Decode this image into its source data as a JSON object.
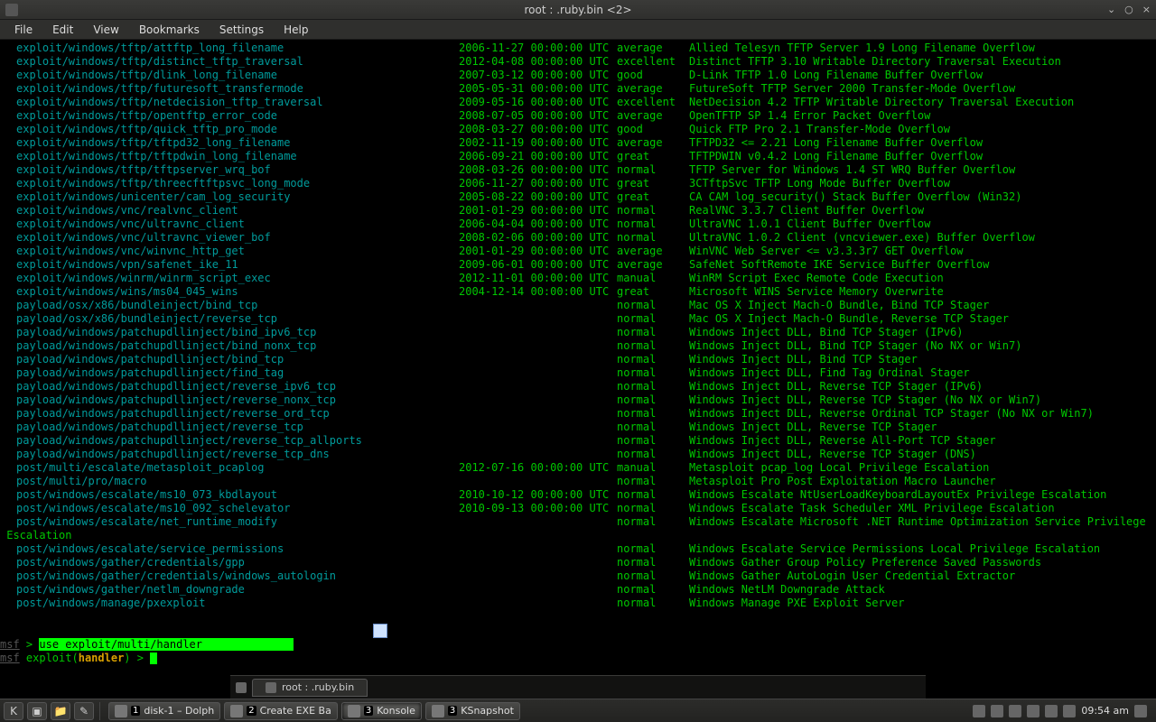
{
  "window": {
    "title": "root : .ruby.bin <2>",
    "controls": {
      "min": "⌄",
      "max": "○",
      "close": "×"
    }
  },
  "menubar": [
    "File",
    "Edit",
    "View",
    "Bookmarks",
    "Settings",
    "Help"
  ],
  "rows": [
    {
      "name": "exploit/windows/tftp/attftp_long_filename",
      "date": "2006-11-27 00:00:00 UTC",
      "rank": "average",
      "desc": "Allied Telesyn TFTP Server 1.9 Long Filename Overflow"
    },
    {
      "name": "exploit/windows/tftp/distinct_tftp_traversal",
      "date": "2012-04-08 00:00:00 UTC",
      "rank": "excellent",
      "desc": "Distinct TFTP 3.10 Writable Directory Traversal Execution"
    },
    {
      "name": "exploit/windows/tftp/dlink_long_filename",
      "date": "2007-03-12 00:00:00 UTC",
      "rank": "good",
      "desc": "D-Link TFTP 1.0 Long Filename Buffer Overflow"
    },
    {
      "name": "exploit/windows/tftp/futuresoft_transfermode",
      "date": "2005-05-31 00:00:00 UTC",
      "rank": "average",
      "desc": "FutureSoft TFTP Server 2000 Transfer-Mode Overflow"
    },
    {
      "name": "exploit/windows/tftp/netdecision_tftp_traversal",
      "date": "2009-05-16 00:00:00 UTC",
      "rank": "excellent",
      "desc": "NetDecision 4.2 TFTP Writable Directory Traversal Execution"
    },
    {
      "name": "exploit/windows/tftp/opentftp_error_code",
      "date": "2008-07-05 00:00:00 UTC",
      "rank": "average",
      "desc": "OpenTFTP SP 1.4 Error Packet Overflow"
    },
    {
      "name": "exploit/windows/tftp/quick_tftp_pro_mode",
      "date": "2008-03-27 00:00:00 UTC",
      "rank": "good",
      "desc": "Quick FTP Pro 2.1 Transfer-Mode Overflow"
    },
    {
      "name": "exploit/windows/tftp/tftpd32_long_filename",
      "date": "2002-11-19 00:00:00 UTC",
      "rank": "average",
      "desc": "TFTPD32 <= 2.21 Long Filename Buffer Overflow"
    },
    {
      "name": "exploit/windows/tftp/tftpdwin_long_filename",
      "date": "2006-09-21 00:00:00 UTC",
      "rank": "great",
      "desc": "TFTPDWIN v0.4.2 Long Filename Buffer Overflow"
    },
    {
      "name": "exploit/windows/tftp/tftpserver_wrq_bof",
      "date": "2008-03-26 00:00:00 UTC",
      "rank": "normal",
      "desc": "TFTP Server for Windows 1.4 ST WRQ Buffer Overflow"
    },
    {
      "name": "exploit/windows/tftp/threecftftpsvc_long_mode",
      "date": "2006-11-27 00:00:00 UTC",
      "rank": "great",
      "desc": "3CTftpSvc TFTP Long Mode Buffer Overflow"
    },
    {
      "name": "exploit/windows/unicenter/cam_log_security",
      "date": "2005-08-22 00:00:00 UTC",
      "rank": "great",
      "desc": "CA CAM log_security() Stack Buffer Overflow (Win32)"
    },
    {
      "name": "exploit/windows/vnc/realvnc_client",
      "date": "2001-01-29 00:00:00 UTC",
      "rank": "normal",
      "desc": "RealVNC 3.3.7 Client Buffer Overflow"
    },
    {
      "name": "exploit/windows/vnc/ultravnc_client",
      "date": "2006-04-04 00:00:00 UTC",
      "rank": "normal",
      "desc": "UltraVNC 1.0.1 Client Buffer Overflow"
    },
    {
      "name": "exploit/windows/vnc/ultravnc_viewer_bof",
      "date": "2008-02-06 00:00:00 UTC",
      "rank": "normal",
      "desc": "UltraVNC 1.0.2 Client (vncviewer.exe) Buffer Overflow"
    },
    {
      "name": "exploit/windows/vnc/winvnc_http_get",
      "date": "2001-01-29 00:00:00 UTC",
      "rank": "average",
      "desc": "WinVNC Web Server <= v3.3.3r7 GET Overflow"
    },
    {
      "name": "exploit/windows/vpn/safenet_ike_11",
      "date": "2009-06-01 00:00:00 UTC",
      "rank": "average",
      "desc": "SafeNet SoftRemote IKE Service Buffer Overflow"
    },
    {
      "name": "exploit/windows/winrm/winrm_script_exec",
      "date": "2012-11-01 00:00:00 UTC",
      "rank": "manual",
      "desc": "WinRM Script Exec Remote Code Execution"
    },
    {
      "name": "exploit/windows/wins/ms04_045_wins",
      "date": "2004-12-14 00:00:00 UTC",
      "rank": "great",
      "desc": "Microsoft WINS Service Memory Overwrite"
    },
    {
      "name": "payload/osx/x86/bundleinject/bind_tcp",
      "date": "",
      "rank": "normal",
      "desc": "Mac OS X Inject Mach-O Bundle, Bind TCP Stager"
    },
    {
      "name": "payload/osx/x86/bundleinject/reverse_tcp",
      "date": "",
      "rank": "normal",
      "desc": "Mac OS X Inject Mach-O Bundle, Reverse TCP Stager"
    },
    {
      "name": "payload/windows/patchupdllinject/bind_ipv6_tcp",
      "date": "",
      "rank": "normal",
      "desc": "Windows Inject DLL, Bind TCP Stager (IPv6)"
    },
    {
      "name": "payload/windows/patchupdllinject/bind_nonx_tcp",
      "date": "",
      "rank": "normal",
      "desc": "Windows Inject DLL, Bind TCP Stager (No NX or Win7)"
    },
    {
      "name": "payload/windows/patchupdllinject/bind_tcp",
      "date": "",
      "rank": "normal",
      "desc": "Windows Inject DLL, Bind TCP Stager"
    },
    {
      "name": "payload/windows/patchupdllinject/find_tag",
      "date": "",
      "rank": "normal",
      "desc": "Windows Inject DLL, Find Tag Ordinal Stager"
    },
    {
      "name": "payload/windows/patchupdllinject/reverse_ipv6_tcp",
      "date": "",
      "rank": "normal",
      "desc": "Windows Inject DLL, Reverse TCP Stager (IPv6)"
    },
    {
      "name": "payload/windows/patchupdllinject/reverse_nonx_tcp",
      "date": "",
      "rank": "normal",
      "desc": "Windows Inject DLL, Reverse TCP Stager (No NX or Win7)"
    },
    {
      "name": "payload/windows/patchupdllinject/reverse_ord_tcp",
      "date": "",
      "rank": "normal",
      "desc": "Windows Inject DLL, Reverse Ordinal TCP Stager (No NX or Win7)"
    },
    {
      "name": "payload/windows/patchupdllinject/reverse_tcp",
      "date": "",
      "rank": "normal",
      "desc": "Windows Inject DLL, Reverse TCP Stager"
    },
    {
      "name": "payload/windows/patchupdllinject/reverse_tcp_allports",
      "date": "",
      "rank": "normal",
      "desc": "Windows Inject DLL, Reverse All-Port TCP Stager"
    },
    {
      "name": "payload/windows/patchupdllinject/reverse_tcp_dns",
      "date": "",
      "rank": "normal",
      "desc": "Windows Inject DLL, Reverse TCP Stager (DNS)"
    },
    {
      "name": "post/multi/escalate/metasploit_pcaplog",
      "date": "2012-07-16 00:00:00 UTC",
      "rank": "manual",
      "desc": "Metasploit pcap_log Local Privilege Escalation"
    },
    {
      "name": "post/multi/pro/macro",
      "date": "",
      "rank": "normal",
      "desc": "Metasploit Pro Post Exploitation Macro Launcher"
    },
    {
      "name": "post/windows/escalate/ms10_073_kbdlayout",
      "date": "2010-10-12 00:00:00 UTC",
      "rank": "normal",
      "desc": "Windows Escalate NtUserLoadKeyboardLayoutEx Privilege Escalation"
    },
    {
      "name": "post/windows/escalate/ms10_092_schelevator",
      "date": "2010-09-13 00:00:00 UTC",
      "rank": "normal",
      "desc": "Windows Escalate Task Scheduler XML Privilege Escalation"
    },
    {
      "name": "post/windows/escalate/net_runtime_modify",
      "date": "",
      "rank": "normal",
      "desc": "Windows Escalate Microsoft .NET Runtime Optimization Service Privilege",
      "wrap": "Escalation"
    },
    {
      "name": "post/windows/escalate/service_permissions",
      "date": "",
      "rank": "normal",
      "desc": "Windows Escalate Service Permissions Local Privilege Escalation"
    },
    {
      "name": "post/windows/gather/credentials/gpp",
      "date": "",
      "rank": "normal",
      "desc": "Windows Gather Group Policy Preference Saved Passwords"
    },
    {
      "name": "post/windows/gather/credentials/windows_autologin",
      "date": "",
      "rank": "normal",
      "desc": "Windows Gather AutoLogin User Credential Extractor"
    },
    {
      "name": "post/windows/gather/netlm_downgrade",
      "date": "",
      "rank": "normal",
      "desc": "Windows NetLM Downgrade Attack"
    },
    {
      "name": "post/windows/manage/pxexploit",
      "date": "",
      "rank": "normal",
      "desc": "Windows Manage PXE Exploit Server"
    }
  ],
  "prompt1": {
    "msf": "msf",
    "gt": " > ",
    "cmd": "use exploit/multi/handler "
  },
  "prompt2": {
    "msf": "msf",
    "mid": " exploit(",
    "mod": "handler",
    "end": ") > "
  },
  "tabbar": {
    "title": "root : .ruby.bin"
  },
  "taskbar": {
    "items": [
      {
        "num": "1",
        "label": "disk-1 – Dolph"
      },
      {
        "num": "2",
        "label": "Create EXE Ba"
      },
      {
        "num": "3",
        "label": "Konsole"
      },
      {
        "num": "3",
        "label": "KSnapshot"
      }
    ],
    "clock": "09:54 am"
  }
}
